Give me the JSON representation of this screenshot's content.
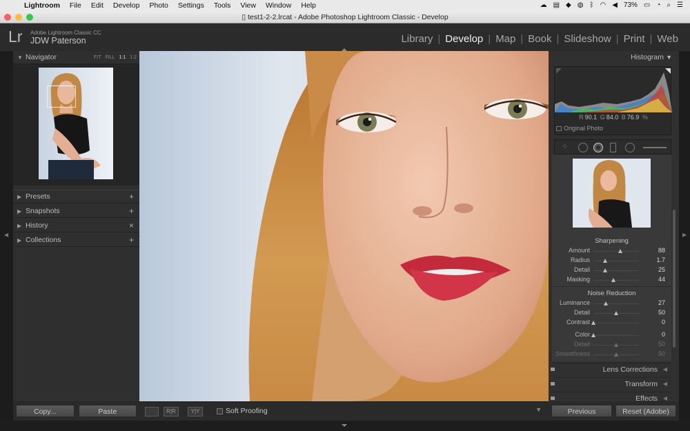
{
  "menubar": {
    "items": [
      "Lightroom",
      "File",
      "Edit",
      "Develop",
      "Photo",
      "Settings",
      "Tools",
      "View",
      "Window",
      "Help"
    ],
    "battery": "73%"
  },
  "window": {
    "title": "test1-2-2.lrcat - Adobe Photoshop Lightroom Classic - Develop"
  },
  "identity": {
    "logo": "Lr",
    "app_name": "Adobe Lightroom Classic CC",
    "user_name": "JDW Paterson"
  },
  "modules": [
    "Library",
    "Develop",
    "Map",
    "Book",
    "Slideshow",
    "Print",
    "Web"
  ],
  "active_module": "Develop",
  "left_panel": {
    "navigator": {
      "title": "Navigator",
      "zoom_options": [
        "FIT",
        "FILL",
        "1:1",
        "1:2"
      ],
      "active_zoom": "1:1"
    },
    "sections": [
      {
        "label": "Presets",
        "action": "+"
      },
      {
        "label": "Snapshots",
        "action": "+"
      },
      {
        "label": "History",
        "action": "×"
      },
      {
        "label": "Collections",
        "action": "+"
      }
    ],
    "copy_button": "Copy...",
    "paste_button": "Paste"
  },
  "toolbar": {
    "soft_proofing_label": "Soft Proofing",
    "view_labels": [
      "R|R",
      "Y|Y"
    ]
  },
  "right_panel": {
    "histogram_title": "Histogram",
    "rgb": {
      "r_label": "R",
      "r": "90.1",
      "g_label": "G",
      "g": "84.0",
      "b_label": "B",
      "b": "76.9",
      "unit": "%"
    },
    "original_photo_label": "Original Photo",
    "sharpening": {
      "title": "Sharpening",
      "rows": [
        {
          "label": "Amount",
          "value": "88",
          "position": 0.59
        },
        {
          "label": "Radius",
          "value": "1.7",
          "position": 0.26
        },
        {
          "label": "Detail",
          "value": "25",
          "position": 0.25
        },
        {
          "label": "Masking",
          "value": "44",
          "position": 0.44
        }
      ]
    },
    "noise_reduction": {
      "title": "Noise Reduction",
      "rows": [
        {
          "label": "Luminance",
          "value": "27",
          "position": 0.27,
          "dim": false
        },
        {
          "label": "Detail",
          "value": "50",
          "position": 0.5,
          "dim": false
        },
        {
          "label": "Contrast",
          "value": "0",
          "position": 0.0,
          "dim": false
        },
        {
          "label": "Color",
          "value": "0",
          "position": 0.0,
          "dim": false
        },
        {
          "label": "Detail",
          "value": "50",
          "position": 0.5,
          "dim": true
        },
        {
          "label": "Smoothness",
          "value": "50",
          "position": 0.5,
          "dim": true
        }
      ]
    },
    "collapsed_sections": [
      "Lens Corrections",
      "Transform",
      "Effects"
    ],
    "previous_button": "Previous",
    "reset_button": "Reset (Adobe)"
  }
}
